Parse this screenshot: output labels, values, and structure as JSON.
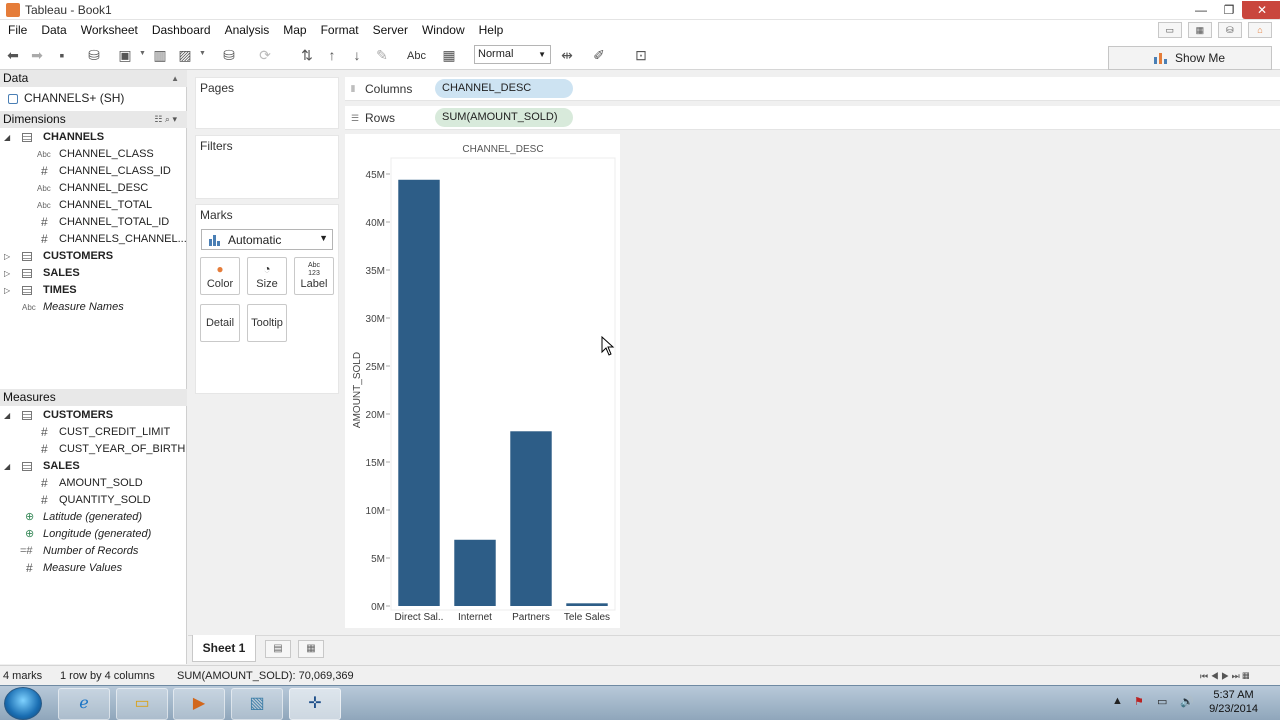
{
  "window": {
    "title": "Tableau - Book1",
    "minimize": "—",
    "maximize": "❐",
    "close": "✕"
  },
  "menu": [
    "File",
    "Data",
    "Worksheet",
    "Dashboard",
    "Analysis",
    "Map",
    "Format",
    "Server",
    "Window",
    "Help"
  ],
  "toolbar": {
    "fit_value": "Normal",
    "abc_label": "Abc",
    "show_me": "Show Me"
  },
  "data_pane": {
    "header": "Data",
    "datasource": "CHANNELS+ (SH)",
    "dimensions_header": "Dimensions",
    "dimensions": [
      {
        "name": "CHANNELS",
        "type": "table",
        "expanded": true
      },
      {
        "name": "CHANNEL_CLASS",
        "type": "abc"
      },
      {
        "name": "CHANNEL_CLASS_ID",
        "type": "num"
      },
      {
        "name": "CHANNEL_DESC",
        "type": "abc"
      },
      {
        "name": "CHANNEL_TOTAL",
        "type": "abc"
      },
      {
        "name": "CHANNEL_TOTAL_ID",
        "type": "num"
      },
      {
        "name": "CHANNELS_CHANNEL...",
        "type": "num"
      },
      {
        "name": "CUSTOMERS",
        "type": "table",
        "expanded": false
      },
      {
        "name": "SALES",
        "type": "table",
        "expanded": false
      },
      {
        "name": "TIMES",
        "type": "table",
        "expanded": false
      },
      {
        "name": "Measure Names",
        "type": "abc-italic"
      }
    ],
    "measures_header": "Measures",
    "measures": [
      {
        "name": "CUSTOMERS",
        "type": "table",
        "expanded": true
      },
      {
        "name": "CUST_CREDIT_LIMIT",
        "type": "num"
      },
      {
        "name": "CUST_YEAR_OF_BIRTH",
        "type": "num"
      },
      {
        "name": "SALES",
        "type": "table",
        "expanded": true
      },
      {
        "name": "AMOUNT_SOLD",
        "type": "num"
      },
      {
        "name": "QUANTITY_SOLD",
        "type": "num"
      },
      {
        "name": "Latitude (generated)",
        "type": "geo"
      },
      {
        "name": "Longitude (generated)",
        "type": "geo"
      },
      {
        "name": "Number of Records",
        "type": "calc"
      },
      {
        "name": "Measure Values",
        "type": "num-italic"
      }
    ]
  },
  "cards": {
    "pages": "Pages",
    "filters": "Filters",
    "marks": "Marks",
    "mark_type": "Automatic"
  },
  "mark_buttons": [
    "Color",
    "Size",
    "Label",
    "Detail",
    "Tooltip"
  ],
  "label_icon_text": "Abc\n123",
  "shelves": {
    "columns_label": "Columns",
    "columns_pill": "CHANNEL_DESC",
    "rows_label": "Rows",
    "rows_pill": "SUM(AMOUNT_SOLD)"
  },
  "colors": {
    "bar": "#2d5d87",
    "columns_pill": "#cde3f2",
    "rows_pill": "#d8eadb"
  },
  "chart_data": {
    "type": "bar",
    "title": "CHANNEL_DESC",
    "ylabel": "AMOUNT_SOLD",
    "xlabel": "",
    "categories": [
      "Direct Sal..",
      "Internet",
      "Partners",
      "Tele Sales"
    ],
    "values": [
      44400000,
      6900000,
      18200000,
      280000
    ],
    "ylim": [
      0,
      45000000
    ],
    "yticks": [
      0,
      5000000,
      10000000,
      15000000,
      20000000,
      25000000,
      30000000,
      35000000,
      40000000,
      45000000
    ],
    "ytick_labels": [
      "0M",
      "5M",
      "10M",
      "15M",
      "20M",
      "25M",
      "30M",
      "35M",
      "40M",
      "45M"
    ],
    "grid": false
  },
  "sheet_tab": "Sheet 1",
  "status": {
    "marks": "4 marks",
    "dims": "1 row by 4 columns",
    "sum": "SUM(AMOUNT_SOLD): 70,069,369"
  },
  "clock": {
    "time": "5:37 AM",
    "date": "9/23/2014"
  }
}
